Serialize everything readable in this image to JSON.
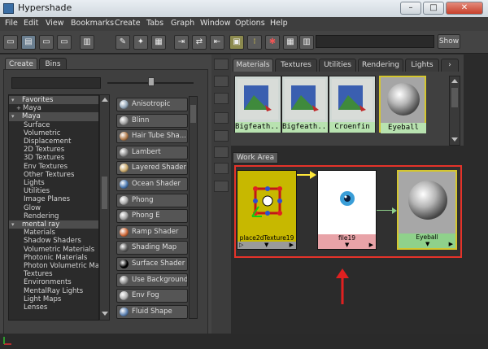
{
  "window": {
    "title": "Hypershade",
    "min_label": "–",
    "max_label": "□",
    "close_label": "✕"
  },
  "menu": [
    "File",
    "Edit",
    "View",
    "Bookmarks",
    "Create",
    "Tabs",
    "Graph",
    "Window",
    "Options",
    "Help"
  ],
  "toolbar": {
    "show_label": "Show"
  },
  "left_tabs": {
    "create": "Create",
    "bins": "Bins"
  },
  "tree": [
    {
      "label": "Favorites",
      "header": true,
      "exp": "▾"
    },
    {
      "label": "Maya",
      "header": false,
      "exp": "+",
      "indent": 2
    },
    {
      "label": "Maya",
      "header": true,
      "exp": "▾"
    },
    {
      "label": "Surface"
    },
    {
      "label": "Volumetric"
    },
    {
      "label": "Displacement"
    },
    {
      "label": "2D Textures"
    },
    {
      "label": "3D Textures"
    },
    {
      "label": "Env Textures"
    },
    {
      "label": "Other Textures"
    },
    {
      "label": "Lights"
    },
    {
      "label": "Utilities"
    },
    {
      "label": "Image Planes"
    },
    {
      "label": "Glow"
    },
    {
      "label": "Rendering"
    },
    {
      "label": "mental ray",
      "header": true,
      "exp": "▾"
    },
    {
      "label": "Materials"
    },
    {
      "label": "Shadow Shaders"
    },
    {
      "label": "Volumetric Materials"
    },
    {
      "label": "Photonic Materials"
    },
    {
      "label": "Photon Volumetric Ma..."
    },
    {
      "label": "Textures"
    },
    {
      "label": "Environments"
    },
    {
      "label": "MentalRay Lights"
    },
    {
      "label": "Light Maps"
    },
    {
      "label": "Lenses"
    }
  ],
  "shaders": [
    {
      "label": "Anisotropic",
      "icon": "#8fa3b5"
    },
    {
      "label": "Blinn",
      "icon": "#9a9a9a"
    },
    {
      "label": "Hair Tube Sha...",
      "icon": "#b07a4a"
    },
    {
      "label": "Lambert",
      "icon": "#8a8a8a"
    },
    {
      "label": "Layered Shader",
      "icon": "#c9a86a"
    },
    {
      "label": "Ocean Shader",
      "icon": "#4a78b0"
    },
    {
      "label": "Phong",
      "icon": "#aaaaaa"
    },
    {
      "label": "Phong E",
      "icon": "#a0a0a0"
    },
    {
      "label": "Ramp Shader",
      "icon": "#d06a3a"
    },
    {
      "label": "Shading Map",
      "icon": "#5a5a5a"
    },
    {
      "label": "Surface Shader",
      "icon": "#000000"
    },
    {
      "label": "Use Background",
      "icon": "#8f8f8f"
    },
    {
      "label": "Env Fog",
      "icon": "#b0b0b0"
    },
    {
      "label": "Fluid Shape",
      "icon": "#5a7fb0"
    }
  ],
  "material_tabs": [
    "Materials",
    "Textures",
    "Utilities",
    "Rendering",
    "Lights"
  ],
  "materials": [
    "Bigfeath...",
    "Bigfeath...",
    "Croenfin",
    "Eyeball"
  ],
  "work_area": {
    "tab_label": "Work Area",
    "nodes": [
      {
        "name": "place2dTexture19"
      },
      {
        "name": "file19"
      },
      {
        "name": "Eyeball"
      }
    ]
  },
  "colors": {
    "highlight_box": "#e5332a",
    "node_place2d": "#c7b800",
    "node_file": "#e8a3a8",
    "node_eyeball": "#8fd18b"
  }
}
